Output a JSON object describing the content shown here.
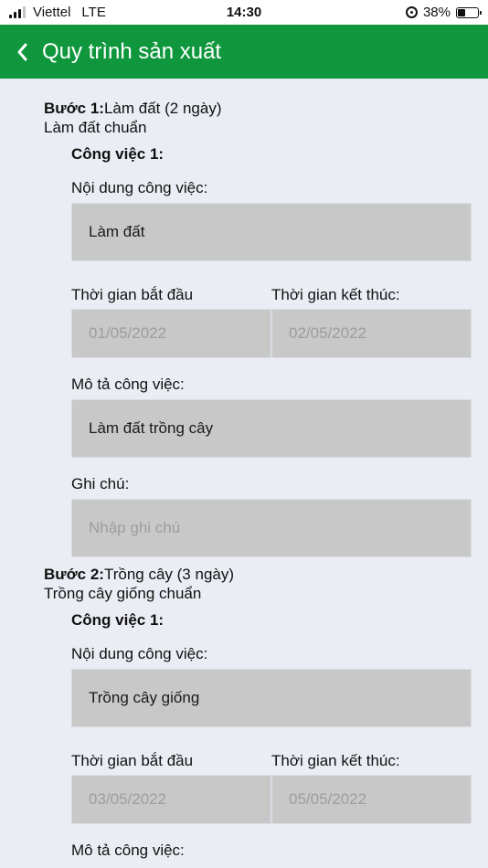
{
  "status_bar": {
    "carrier": "Viettel",
    "network": "LTE",
    "time": "14:30",
    "battery": "38%",
    "battery_level": 0.38
  },
  "header": {
    "title": "Quy trình sản xuất"
  },
  "steps": [
    {
      "label": "Bước 1:",
      "name": "Làm đất (2 ngày)",
      "description": "Làm đất chuẩn",
      "task": {
        "title": "Công việc 1:",
        "content_label": "Nội dung công việc:",
        "content_value": "Làm đất",
        "start_label": "Thời gian bắt đầu",
        "end_label": "Thời gian kết thúc:",
        "start_value": "01/05/2022",
        "end_value": "02/05/2022",
        "desc_label": "Mô tả công việc:",
        "desc_value": "Làm đất trồng cây",
        "note_label": "Ghi chú:",
        "note_placeholder": "Nhập ghi chú"
      }
    },
    {
      "label": "Bước 2:",
      "name": "Trồng cây (3 ngày)",
      "description": "Trồng cây giống chuẩn",
      "task": {
        "title": "Công việc 1:",
        "content_label": "Nội dung công việc:",
        "content_value": "Trồng cây giống",
        "start_label": "Thời gian bắt đầu",
        "end_label": "Thời gian kết thúc:",
        "start_value": "03/05/2022",
        "end_value": "05/05/2022",
        "desc_label": "Mô tả công việc:"
      }
    }
  ]
}
